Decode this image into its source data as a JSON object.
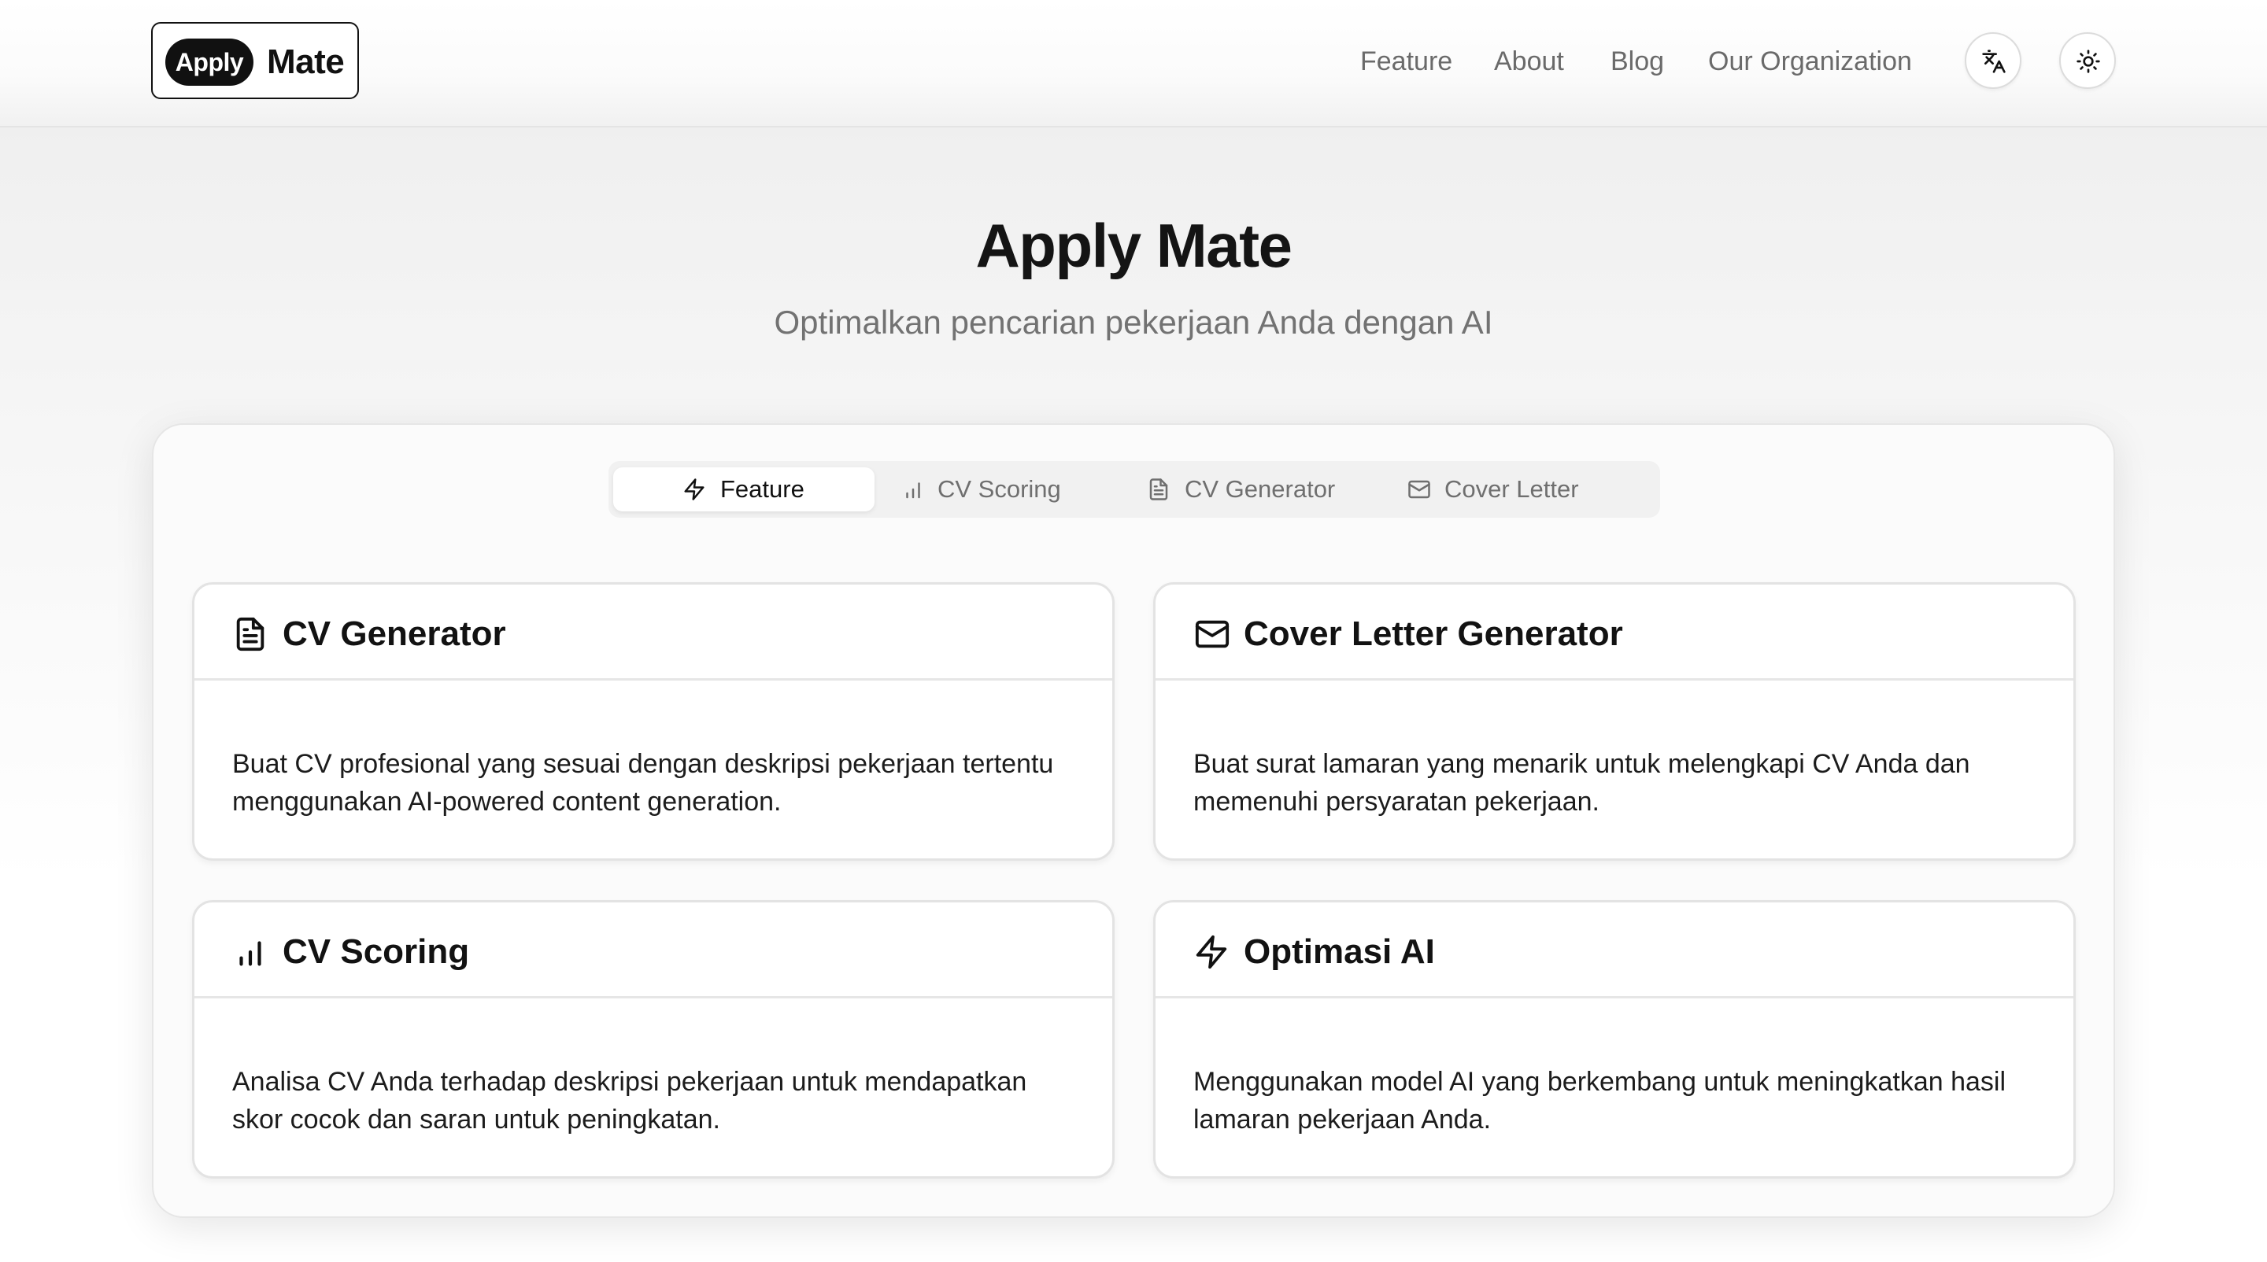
{
  "header": {
    "logo": {
      "pill_text": "Apply",
      "word_text": "Mate"
    },
    "nav": [
      "Feature",
      "About",
      "Blog",
      "Our Organization"
    ],
    "icons": {
      "language": "translate-icon",
      "theme": "sun-icon"
    }
  },
  "hero": {
    "title": "Apply Mate",
    "subtitle": "Optimalkan pencarian pekerjaan Anda dengan AI"
  },
  "tabs": [
    {
      "label": "Feature",
      "icon": "zap-icon",
      "active": true
    },
    {
      "label": "CV Scoring",
      "icon": "bar-chart-icon",
      "active": false
    },
    {
      "label": "CV Generator",
      "icon": "document-icon",
      "active": false
    },
    {
      "label": "Cover Letter",
      "icon": "mail-icon",
      "active": false
    }
  ],
  "features": [
    {
      "title": "CV Generator",
      "icon": "document-icon",
      "description": "Buat CV profesional yang sesuai dengan deskripsi pekerjaan tertentu menggunakan AI-powered content generation."
    },
    {
      "title": "Cover Letter Generator",
      "icon": "mail-icon",
      "description": "Buat surat lamaran yang menarik untuk melengkapi CV Anda dan memenuhi persyaratan pekerjaan."
    },
    {
      "title": "CV Scoring",
      "icon": "bar-chart-icon",
      "description": "Analisa CV Anda terhadap deskripsi pekerjaan untuk mendapatkan skor cocok dan saran untuk peningkatan."
    },
    {
      "title": "Optimasi AI",
      "icon": "zap-icon",
      "description": "Menggunakan model AI yang berkembang untuk meningkatkan hasil lamaran pekerjaan Anda."
    }
  ],
  "colors": {
    "text_primary": "#111111",
    "text_muted": "#6f6f6f",
    "border": "#e3e3e3",
    "accent_dark": "#111111"
  }
}
